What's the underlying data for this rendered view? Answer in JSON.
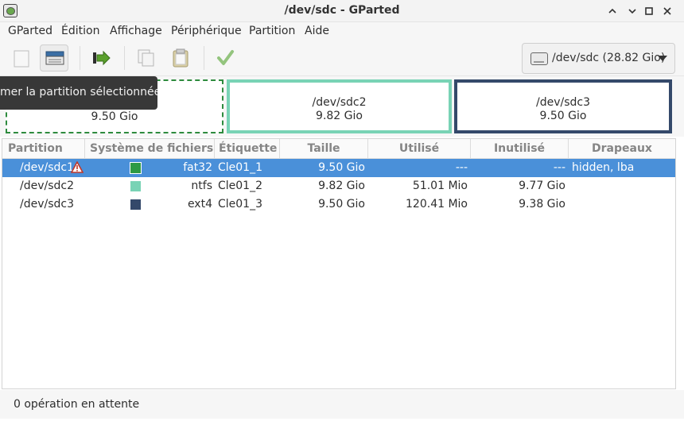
{
  "window": {
    "title": "/dev/sdc - GParted",
    "minimize": "⌃",
    "maximize": "⌄",
    "restore": "□",
    "close": "✕"
  },
  "menu": [
    "GParted",
    "Édition",
    "Affichage",
    "Périphérique",
    "Partition",
    "Aide"
  ],
  "toolbar": {
    "icons": [
      "new-partition-icon",
      "format-icon",
      "resize-move-icon",
      "copy-icon",
      "paste-icon",
      "apply-icon"
    ]
  },
  "device": {
    "label": "/dev/sdc (28.82 Gio)"
  },
  "tooltip": {
    "text": "mer la partition sélectionnée"
  },
  "visual_map": [
    {
      "name": "/dev/sdc1",
      "size": "9.50 Gio",
      "color": "#2e8b3e"
    },
    {
      "name": "/dev/sdc2",
      "size": "9.82 Gio",
      "color": "#79d3b5"
    },
    {
      "name": "/dev/sdc3",
      "size": "9.50 Gio",
      "color": "#34496a"
    }
  ],
  "table": {
    "headers": [
      "Partition",
      "Système de fichiers",
      "Étiquette",
      "Taille",
      "Utilisé",
      "Inutilisé",
      "Drapeaux"
    ],
    "rows": [
      {
        "partition": "/dev/sdc1",
        "fs": "fat32",
        "fs_color": "#2e9a44",
        "label": "Cle01_1",
        "size": "9.50 Gio",
        "used": "---",
        "unused": "---",
        "flags": "hidden, lba",
        "warning": true
      },
      {
        "partition": "/dev/sdc2",
        "fs": "ntfs",
        "fs_color": "#79d3b5",
        "label": "Cle01_2",
        "size": "9.82 Gio",
        "used": "51.01 Mio",
        "unused": "9.77 Gio",
        "flags": "",
        "warning": false
      },
      {
        "partition": "/dev/sdc3",
        "fs": "ext4",
        "fs_color": "#34496a",
        "label": "Cle01_3",
        "size": "9.50 Gio",
        "used": "120.41 Mio",
        "unused": "9.38 Gio",
        "flags": "",
        "warning": false
      }
    ],
    "selected_row": 0
  },
  "status": {
    "text": "0 opération en attente"
  },
  "colors": {
    "selection": "#4a90d9",
    "header_text": "#858585"
  }
}
